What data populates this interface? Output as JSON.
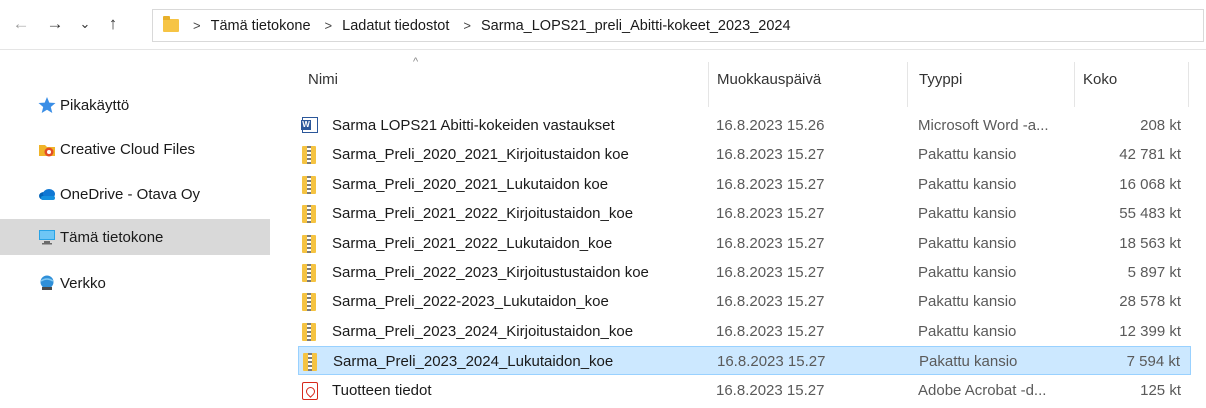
{
  "address_bar": {
    "crumbs": [
      "Tämä tietokone",
      "Ladatut tiedostot",
      "Sarma_LOPS21_preli_Abitti-kokeet_2023_2024"
    ],
    "separator": ">"
  },
  "nav": {
    "back": "←",
    "forward": "→",
    "recent": "⌄",
    "up": "↑"
  },
  "sidebar": {
    "items": [
      {
        "label": "Pikakäyttö",
        "icon": "star-icon"
      },
      {
        "label": "Creative Cloud Files",
        "icon": "creative-cloud-icon"
      },
      {
        "label": "OneDrive - Otava Oy",
        "icon": "onedrive-cloud-icon"
      },
      {
        "label": "Tämä tietokone",
        "icon": "computer-icon",
        "selected": true
      },
      {
        "label": "Verkko",
        "icon": "network-icon"
      }
    ]
  },
  "columns": {
    "name": "Nimi",
    "date": "Muokkauspäivä",
    "type": "Tyyppi",
    "size": "Koko",
    "sort_indicator": "^"
  },
  "files": [
    {
      "icon": "word-document-icon",
      "name": "Sarma LOPS21 Abitti-kokeiden vastaukset",
      "date": "16.8.2023 15.26",
      "type": "Microsoft Word -a...",
      "size": "208 kt"
    },
    {
      "icon": "zip-folder-icon",
      "name": "Sarma_Preli_2020_2021_Kirjoitustaidon koe",
      "date": "16.8.2023 15.27",
      "type": "Pakattu kansio",
      "size": "42 781 kt"
    },
    {
      "icon": "zip-folder-icon",
      "name": "Sarma_Preli_2020_2021_Lukutaidon koe",
      "date": "16.8.2023 15.27",
      "type": "Pakattu kansio",
      "size": "16 068 kt"
    },
    {
      "icon": "zip-folder-icon",
      "name": "Sarma_Preli_2021_2022_Kirjoitustaidon_koe",
      "date": "16.8.2023 15.27",
      "type": "Pakattu kansio",
      "size": "55 483 kt"
    },
    {
      "icon": "zip-folder-icon",
      "name": "Sarma_Preli_2021_2022_Lukutaidon_koe",
      "date": "16.8.2023 15.27",
      "type": "Pakattu kansio",
      "size": "18 563 kt"
    },
    {
      "icon": "zip-folder-icon",
      "name": "Sarma_Preli_2022_2023_Kirjoitustustaidon koe",
      "date": "16.8.2023 15.27",
      "type": "Pakattu kansio",
      "size": "5 897 kt"
    },
    {
      "icon": "zip-folder-icon",
      "name": "Sarma_Preli_2022-2023_Lukutaidon_koe",
      "date": "16.8.2023 15.27",
      "type": "Pakattu kansio",
      "size": "28 578 kt"
    },
    {
      "icon": "zip-folder-icon",
      "name": "Sarma_Preli_2023_2024_Kirjoitustaidon_koe",
      "date": "16.8.2023 15.27",
      "type": "Pakattu kansio",
      "size": "12 399 kt"
    },
    {
      "icon": "zip-folder-icon",
      "name": "Sarma_Preli_2023_2024_Lukutaidon_koe",
      "date": "16.8.2023 15.27",
      "type": "Pakattu kansio",
      "size": "7 594 kt",
      "selected": true
    },
    {
      "icon": "pdf-document-icon",
      "name": "Tuotteen tiedot",
      "date": "16.8.2023 15.27",
      "type": "Adobe Acrobat -d...",
      "size": "125 kt"
    }
  ],
  "colors": {
    "selection_bg": "#cce8ff",
    "selection_border": "#99d1ff",
    "sidebar_selected": "#d9d9d9"
  }
}
